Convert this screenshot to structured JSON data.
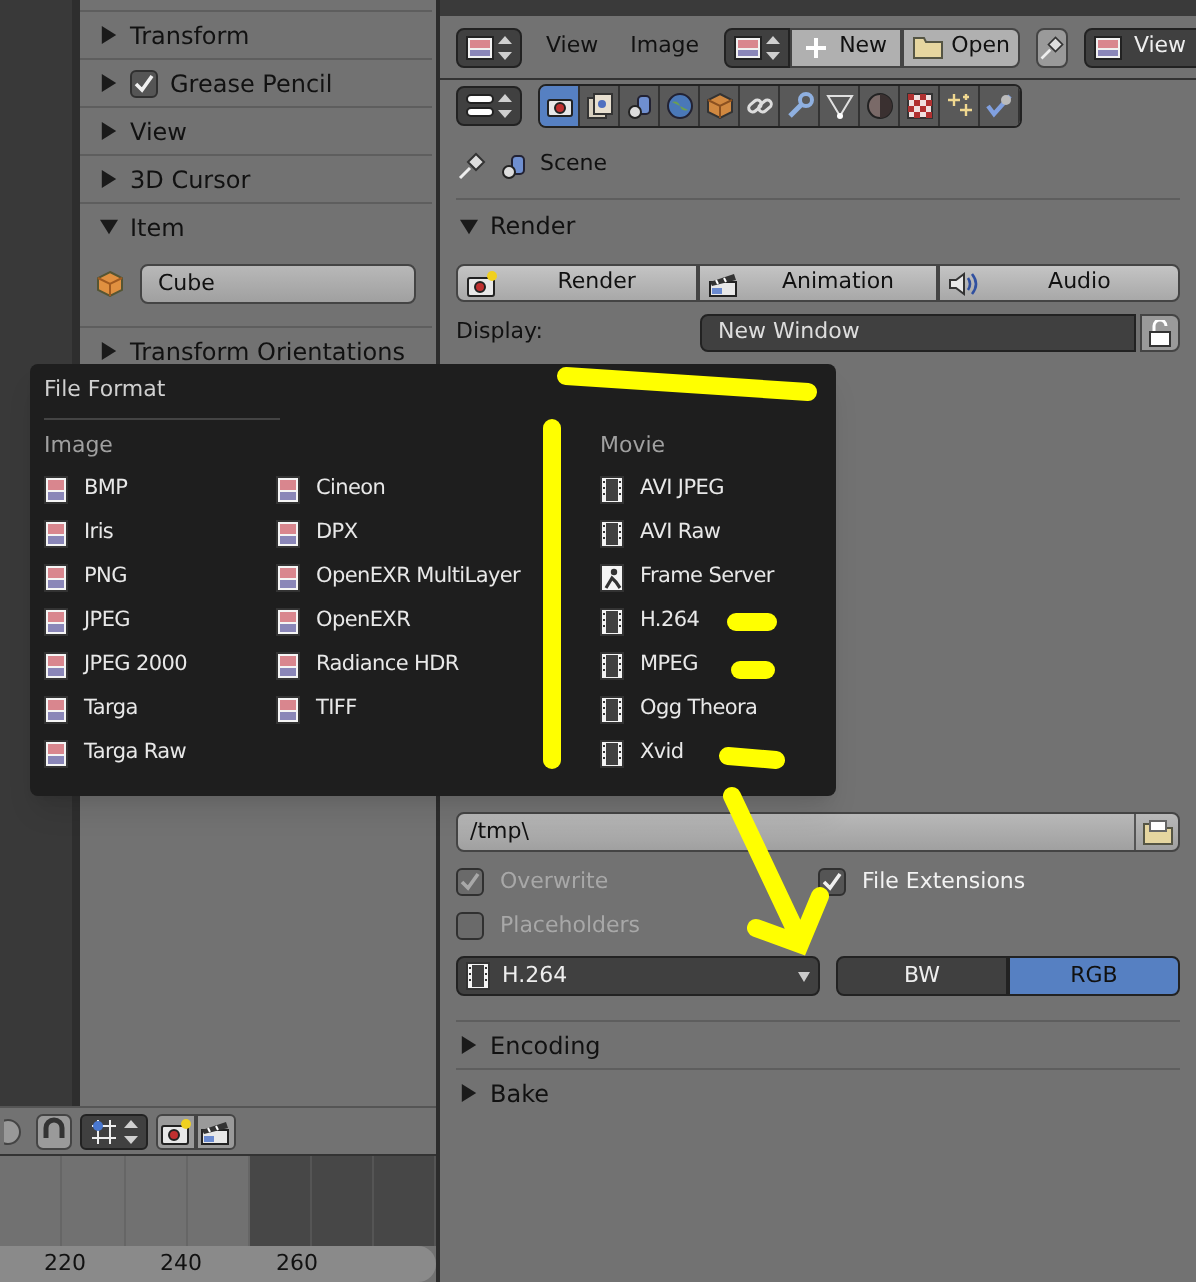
{
  "tool_panel": {
    "panels": [
      {
        "title": "Transform",
        "expanded": false
      },
      {
        "title": "Grease Pencil",
        "expanded": false,
        "checked": true
      },
      {
        "title": "View",
        "expanded": false
      },
      {
        "title": "3D Cursor",
        "expanded": false
      },
      {
        "title": "Item",
        "expanded": true
      }
    ],
    "item_name": "Cube",
    "next_panel": {
      "title": "Transform Orientations",
      "expanded": false
    }
  },
  "header": {
    "menus": [
      "View",
      "Image"
    ],
    "new_button": "New",
    "open_button": "Open",
    "view_menu": "View"
  },
  "property_tabs": [
    {
      "kind": "render",
      "selected": true
    },
    {
      "kind": "layers",
      "selected": false
    },
    {
      "kind": "scene",
      "selected": false
    },
    {
      "kind": "world",
      "selected": false
    },
    {
      "kind": "object",
      "selected": false
    },
    {
      "kind": "constraints",
      "selected": false
    },
    {
      "kind": "modifiers",
      "selected": false
    },
    {
      "kind": "data",
      "selected": false
    },
    {
      "kind": "material",
      "selected": false
    },
    {
      "kind": "texture",
      "selected": false
    },
    {
      "kind": "particles",
      "selected": false
    },
    {
      "kind": "physics",
      "selected": false
    }
  ],
  "context": "Scene",
  "render_panel": {
    "title": "Render",
    "expanded": true,
    "buttons": [
      {
        "label": "Render",
        "kind": "render"
      },
      {
        "label": "Animation",
        "kind": "animation"
      },
      {
        "label": "Audio",
        "kind": "audio"
      }
    ],
    "display_label": "Display:",
    "display_value": "New Window"
  },
  "popup": {
    "title": "File Format",
    "columns": [
      {
        "heading": "Image",
        "items": [
          {
            "label": "BMP",
            "kind": "image"
          },
          {
            "label": "Iris",
            "kind": "image"
          },
          {
            "label": "PNG",
            "kind": "image"
          },
          {
            "label": "JPEG",
            "kind": "image"
          },
          {
            "label": "JPEG 2000",
            "kind": "image"
          },
          {
            "label": "Targa",
            "kind": "image"
          },
          {
            "label": "Targa Raw",
            "kind": "image"
          }
        ]
      },
      {
        "items": [
          {
            "label": "Cineon",
            "kind": "image"
          },
          {
            "label": "DPX",
            "kind": "image"
          },
          {
            "label": "OpenEXR MultiLayer",
            "kind": "image"
          },
          {
            "label": "OpenEXR",
            "kind": "image"
          },
          {
            "label": "Radiance HDR",
            "kind": "image"
          },
          {
            "label": "TIFF",
            "kind": "image"
          }
        ]
      },
      {
        "heading": "Movie",
        "items": [
          {
            "label": "AVI JPEG",
            "kind": "movie"
          },
          {
            "label": "AVI Raw",
            "kind": "movie"
          },
          {
            "label": "Frame Server",
            "kind": "server"
          },
          {
            "label": "H.264",
            "kind": "movie"
          },
          {
            "label": "MPEG",
            "kind": "movie"
          },
          {
            "label": "Ogg Theora",
            "kind": "movie"
          },
          {
            "label": "Xvid",
            "kind": "movie"
          }
        ]
      }
    ]
  },
  "output": {
    "path": "/tmp\\",
    "options": [
      {
        "label": "Overwrite",
        "checked": true,
        "disabled": true
      },
      {
        "label": "File Extensions",
        "checked": true,
        "disabled": false
      },
      {
        "label": "Placeholders",
        "checked": false,
        "disabled": true
      }
    ],
    "format": "H.264",
    "color_modes": [
      {
        "label": "BW",
        "selected": false
      },
      {
        "label": "RGB",
        "selected": true
      }
    ]
  },
  "collapsed_panels": [
    {
      "title": "Encoding",
      "expanded": false
    },
    {
      "title": "Bake",
      "expanded": false
    }
  ],
  "timeline": {
    "ticks": [
      "220",
      "240",
      "260"
    ]
  }
}
